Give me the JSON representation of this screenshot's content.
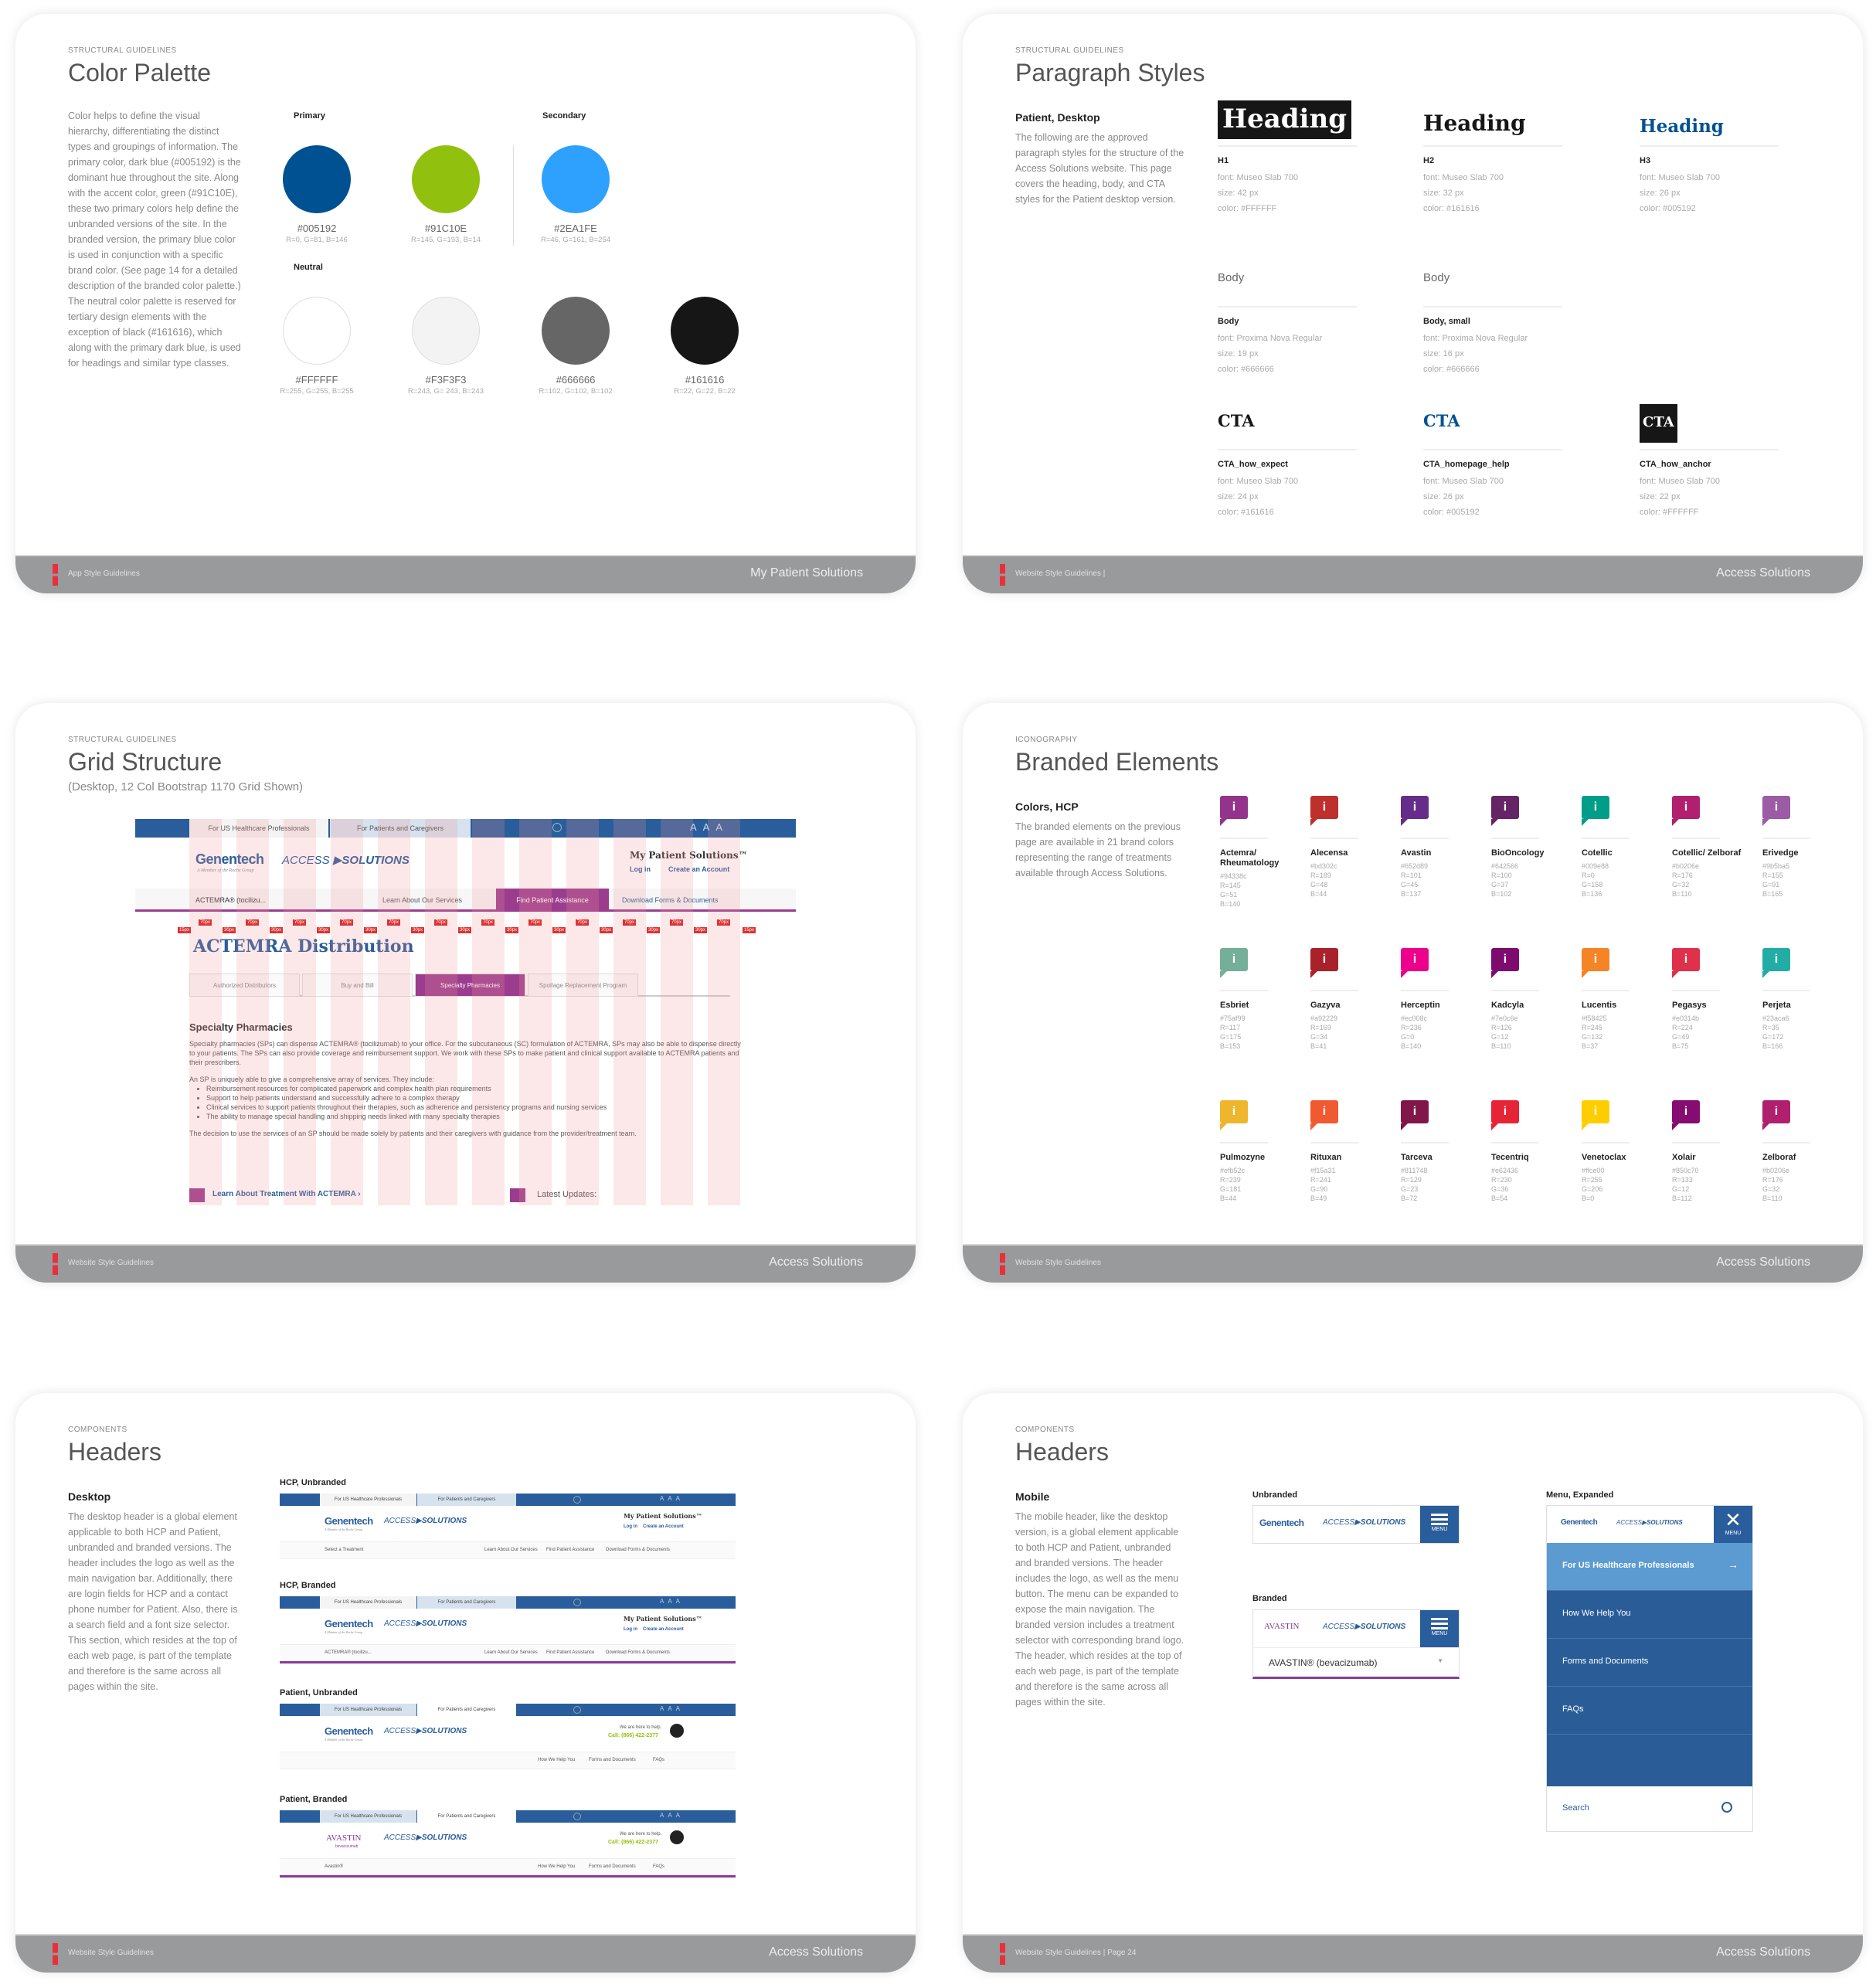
{
  "panels": {
    "color_palette": {
      "kicker": "STRUCTURAL GUIDELINES",
      "title": "Color Palette",
      "description": "Color helps to define the visual hierarchy, differentiating the distinct types and groupings of information. The primary color, dark blue (#005192) is the dominant hue throughout the site. Along with the accent color, green (#91C10E), these two primary colors help define the unbranded versions of the site. In the branded version, the primary blue color is used in conjunction with a specific brand color. (See page 14 for a detailed description of the branded color palette.) The neutral color palette is reserved for tertiary design elements with the exception of black (#161616), which along with the primary dark blue, is used for headings and similar type classes.",
      "primary_label": "Primary",
      "secondary_label": "Secondary",
      "neutral_label": "Neutral",
      "primary": [
        {
          "hex": "#005192",
          "rgb": "R=0, G=81, B=146"
        },
        {
          "hex": "#91C10E",
          "rgb": "R=145, G=193, B=14"
        }
      ],
      "secondary": [
        {
          "hex": "#2EA1FE",
          "rgb": "R=46, G=161, B=254"
        }
      ],
      "neutral": [
        {
          "hex": "#FFFFFF",
          "rgb": "R=255, G=255, B=255"
        },
        {
          "hex": "#F3F3F3",
          "rgb": "R=243, G= 243, B=243"
        },
        {
          "hex": "#666666",
          "rgb": "R=102, G=102, B=102"
        },
        {
          "hex": "#161616",
          "rgb": "R=22, G=22, B=22"
        }
      ],
      "footer_left": "App Style Guidelines",
      "footer_right": "My Patient Solutions"
    },
    "paragraph_styles": {
      "kicker": "STRUCTURAL GUIDELINES",
      "title": "Paragraph Styles",
      "section": "Patient, Desktop",
      "description": "The following are the approved paragraph styles for the structure of the Access Solutions website. This page covers the heading, body, and CTA styles for the Patient desktop version.",
      "headings": [
        {
          "sample": "Heading",
          "name": "H1",
          "font": "font: Museo Slab 700",
          "size": "size: 42 px",
          "color": "color: #FFFFFF"
        },
        {
          "sample": "Heading",
          "name": "H2",
          "font": "font: Museo Slab 700",
          "size": "size: 32 px",
          "color": "color: #161616"
        },
        {
          "sample": "Heading",
          "name": "H3",
          "font": "font: Museo Slab 700",
          "size": "size: 26 px",
          "color": "color: #005192"
        }
      ],
      "bodies": [
        {
          "sample": "Body",
          "name": "Body",
          "font": "font: Proxima Nova Regular",
          "size": "size: 19 px",
          "color": "color: #666666"
        },
        {
          "sample": "Body",
          "name": "Body, small",
          "font": "font: Proxima Nova Regular",
          "size": "size: 16 px",
          "color": "color: #666666"
        }
      ],
      "ctas": [
        {
          "sample": "CTA",
          "name": "CTA_how_expect",
          "font": "font: Museo Slab 700",
          "size": "size: 24 px",
          "color": "color: #161616"
        },
        {
          "sample": "CTA",
          "name": "CTA_homepage_help",
          "font": "font: Museo Slab 700",
          "size": "size: 26 px",
          "color": "color: #005192"
        },
        {
          "sample": "CTA",
          "name": "CTA_how_anchor",
          "font": "font: Museo Slab 700",
          "size": "size: 22 px",
          "color": "color: #FFFFFF"
        }
      ],
      "footer_left": "Website Style Guidelines  |",
      "footer_right": "Access Solutions"
    },
    "grid_structure": {
      "kicker": "STRUCTURAL GUIDELINES",
      "title": "Grid Structure",
      "subtitle": "(Desktop, 12 Col Bootstrap 1170 Grid Shown)",
      "mock": {
        "tab_hcp": "For US Healthcare Professionals",
        "tab_patients": "For Patients and Caregivers",
        "font_sizes": [
          "A",
          "A",
          "A"
        ],
        "logo_main": "Genentech",
        "logo_sub": "A Member of the Roche Group",
        "logo_access": "ACCESS",
        "logo_solutions": "SOLUTIONS",
        "mps": "My Patient Solutions™",
        "login": "Log in",
        "create_account": "Create an Account",
        "treatment_select": "ACTEMRA® (tocilizu...",
        "nav": [
          "Learn About Our Services",
          "Find Patient Assistance",
          "Download Forms & Documents"
        ],
        "gutter_label": "30px",
        "col_label": "70px",
        "edge_label": "15px",
        "page_title": "ACTEMRA Distribution",
        "subtabs": [
          "Authorized Distributors",
          "Buy and Bill",
          "Specialty Pharmacies",
          "Spoilage Replacement Program"
        ],
        "section_heading": "Specialty Pharmacies",
        "body_1": "Specialty pharmacies (SPs) can dispense ACTEMRA® (tocilizumab) to your office. For the subcutaneous (SC) formulation of ACTEMRA, SPs may also be able to dispense directly to your patients. The SPs can also provide coverage and reimbursement support. We work with these SPs to make patient and clinical support available to ACTEMRA patients and their prescribers.",
        "body_2": "An SP is uniquely able to give a comprehensive array of services. They include:",
        "bullets": [
          "Reimbursement resources for complicated paperwork and complex health plan requirements",
          "Support to help patients understand and successfully adhere to a complex therapy",
          "Clinical services to support patients throughout their therapies, such as adherence and persistency programs and nursing services",
          "The ability to manage special handling and shipping needs linked with many specialty therapies"
        ],
        "body_3": "The decision to use the services of an SP should be made solely by patients and their caregivers with guidance from the provider/treatment team.",
        "cta_treatment": "Learn About Treatment With ACTEMRA ›",
        "latest_updates": "Latest Updates:"
      },
      "footer_left": "Website Style Guidelines",
      "footer_right": "Access Solutions"
    },
    "branded_elements": {
      "kicker": "ICONOGRAPHY",
      "title": "Branded Elements",
      "section": "Colors, HCP",
      "description": "The branded elements on the previous page are available in 21 brand colors representing the range of treatments available through Access Solutions.",
      "icon_glyph": "i",
      "brands": [
        {
          "name": "Actemra/ Rheumatology",
          "hex": "#94338c",
          "r": "R=145",
          "g": "G=51",
          "b": "B=140"
        },
        {
          "name": "Alecensa",
          "hex": "#bd302c",
          "r": "R=189",
          "g": "G=48",
          "b": "B=44"
        },
        {
          "name": "Avastin",
          "hex": "#652d89",
          "r": "R=101",
          "g": "G=45",
          "b": "B=137"
        },
        {
          "name": "BioOncology",
          "hex": "#642566",
          "r": "R=100",
          "g": "G=37",
          "b": "B=102"
        },
        {
          "name": "Cotellic",
          "hex": "#009e88",
          "r": "R=0",
          "g": "G=158",
          "b": "B=136"
        },
        {
          "name": "Cotellic/ Zelboraf",
          "hex": "#b0206e",
          "r": "R=176",
          "g": "G=32",
          "b": "B=110"
        },
        {
          "name": "Erivedge",
          "hex": "#9b5ba5",
          "r": "R=155",
          "g": "G=91",
          "b": "B=165"
        },
        {
          "name": "Esbriet",
          "hex": "#75af99",
          "r": "R=117",
          "g": "G=175",
          "b": "B=153"
        },
        {
          "name": "Gazyva",
          "hex": "#a92229",
          "r": "R=169",
          "g": "G=34",
          "b": "B=41"
        },
        {
          "name": "Herceptin",
          "hex": "#ec008c",
          "r": "R=236",
          "g": "G=0",
          "b": "B=140"
        },
        {
          "name": "Kadcyla",
          "hex": "#7e0c6e",
          "r": "R=126",
          "g": "G=12",
          "b": "B=110"
        },
        {
          "name": "Lucentis",
          "hex": "#f58425",
          "r": "R=245",
          "g": "G=132",
          "b": "B=37"
        },
        {
          "name": "Pegasys",
          "hex": "#e0314b",
          "r": "R=224",
          "g": "G=49",
          "b": "B=75"
        },
        {
          "name": "Perjeta",
          "hex": "#23aca6",
          "r": "R=35",
          "g": "G=172",
          "b": "B=166"
        },
        {
          "name": "Pulmozyne",
          "hex": "#efb52c",
          "r": "R=239",
          "g": "G=181",
          "b": "B=44"
        },
        {
          "name": "Rituxan",
          "hex": "#f15a31",
          "r": "R=241",
          "g": "G=90",
          "b": "B=49"
        },
        {
          "name": "Tarceva",
          "hex": "#811748",
          "r": "R=129",
          "g": "G=23",
          "b": "B=72"
        },
        {
          "name": "Tecentriq",
          "hex": "#e62436",
          "r": "R=230",
          "g": "G=36",
          "b": "B=54"
        },
        {
          "name": "Venetoclax",
          "hex": "#ffce00",
          "r": "R=255",
          "g": "G=206",
          "b": "B=0"
        },
        {
          "name": "Xolair",
          "hex": "#850c70",
          "r": "R=133",
          "g": "G=12",
          "b": "B=112"
        },
        {
          "name": "Zelboraf",
          "hex": "#b0206e",
          "r": "R=176",
          "g": "G=32",
          "b": "B=110"
        }
      ],
      "footer_left": "Website Style Guidelines",
      "footer_right": "Access Solutions"
    },
    "headers_desktop": {
      "kicker": "COMPONENTS",
      "title": "Headers",
      "section": "Desktop",
      "description": "The desktop header is a global element applicable to both HCP and Patient, unbranded and branded versions. The header includes the logo as well as the main navigation bar. Additionally, there are login fields for HCP and a contact phone number for Patient. Also, there is a search field and a font size selector. This section, which resides at the top of each web page, is part of the template and therefore is the same across all pages within the site.",
      "variants": [
        {
          "label": "HCP, Unbranded",
          "mode": "hcp",
          "logo": "Genentech",
          "selector": "Select a Treatment",
          "nav": [
            "Learn About Our Services",
            "Find Patient Assistance",
            "Download Forms & Documents"
          ],
          "branded": false
        },
        {
          "label": "HCP, Branded",
          "mode": "hcp",
          "logo": "Genentech",
          "selector": "ACTEMRA® (tocilizu...",
          "nav": [
            "Learn About Our Services",
            "Find Patient Assistance",
            "Download Forms & Documents"
          ],
          "branded": true
        },
        {
          "label": "Patient, Unbranded",
          "mode": "patient",
          "logo": "Genentech",
          "selector": "",
          "nav": [
            "How We Help You",
            "Forms and Documents",
            "FAQs"
          ],
          "branded": false
        },
        {
          "label": "Patient, Branded",
          "mode": "patient",
          "logo": "AVASTIN",
          "selector": "Avastin®",
          "nav": [
            "How We Help You",
            "Forms and Documents",
            "FAQs"
          ],
          "branded": true
        }
      ],
      "tab_hcp": "For US Healthcare Professionals",
      "tab_patients": "For Patients and Caregivers",
      "font_sizes": "AAA",
      "mps": "My Patient Solutions™",
      "login": "Log in",
      "create_account": "Create an Account",
      "help_text": "We are here to help.",
      "phone": "Call: (866) 422-2377",
      "logo_access": "ACCESS",
      "logo_solutions": "SOLUTIONS",
      "logo_sub": "A Member of the Roche Group",
      "avastin_sub": "bevacizumab",
      "footer_left": "Website Style Guidelines",
      "footer_right": "Access Solutions"
    },
    "headers_mobile": {
      "kicker": "COMPONENTS",
      "title": "Headers",
      "section": "Mobile",
      "description": "The mobile header, like the desktop version, is a global element applicable to both HCP and Patient, unbranded and branded versions. The header includes the logo, as well as the menu button. The menu can be expanded to expose the main navigation. The branded version includes a treatment selector with corresponding brand logo. The header, which resides at the top of each web page, is part of the template and therefore is the same across all pages within the site.",
      "unbranded_label": "Unbranded",
      "branded_label": "Branded",
      "expanded_label": "Menu, Expanded",
      "menu_label": "MENU",
      "logo_main": "Genentech",
      "logo_avastin": "AVASTIN",
      "logo_access": "ACCESS",
      "logo_solutions": "SOLUTIONS",
      "treatment_selected": "AVASTIN® (bevacizumab)",
      "menu_items": [
        "For US Healthcare Professionals",
        "How We Help You",
        "Forms and Documents",
        "FAQs"
      ],
      "search_placeholder": "Search",
      "footer_left": "Website Style Guidelines  |  Page 24",
      "footer_right": "Access Solutions"
    }
  }
}
